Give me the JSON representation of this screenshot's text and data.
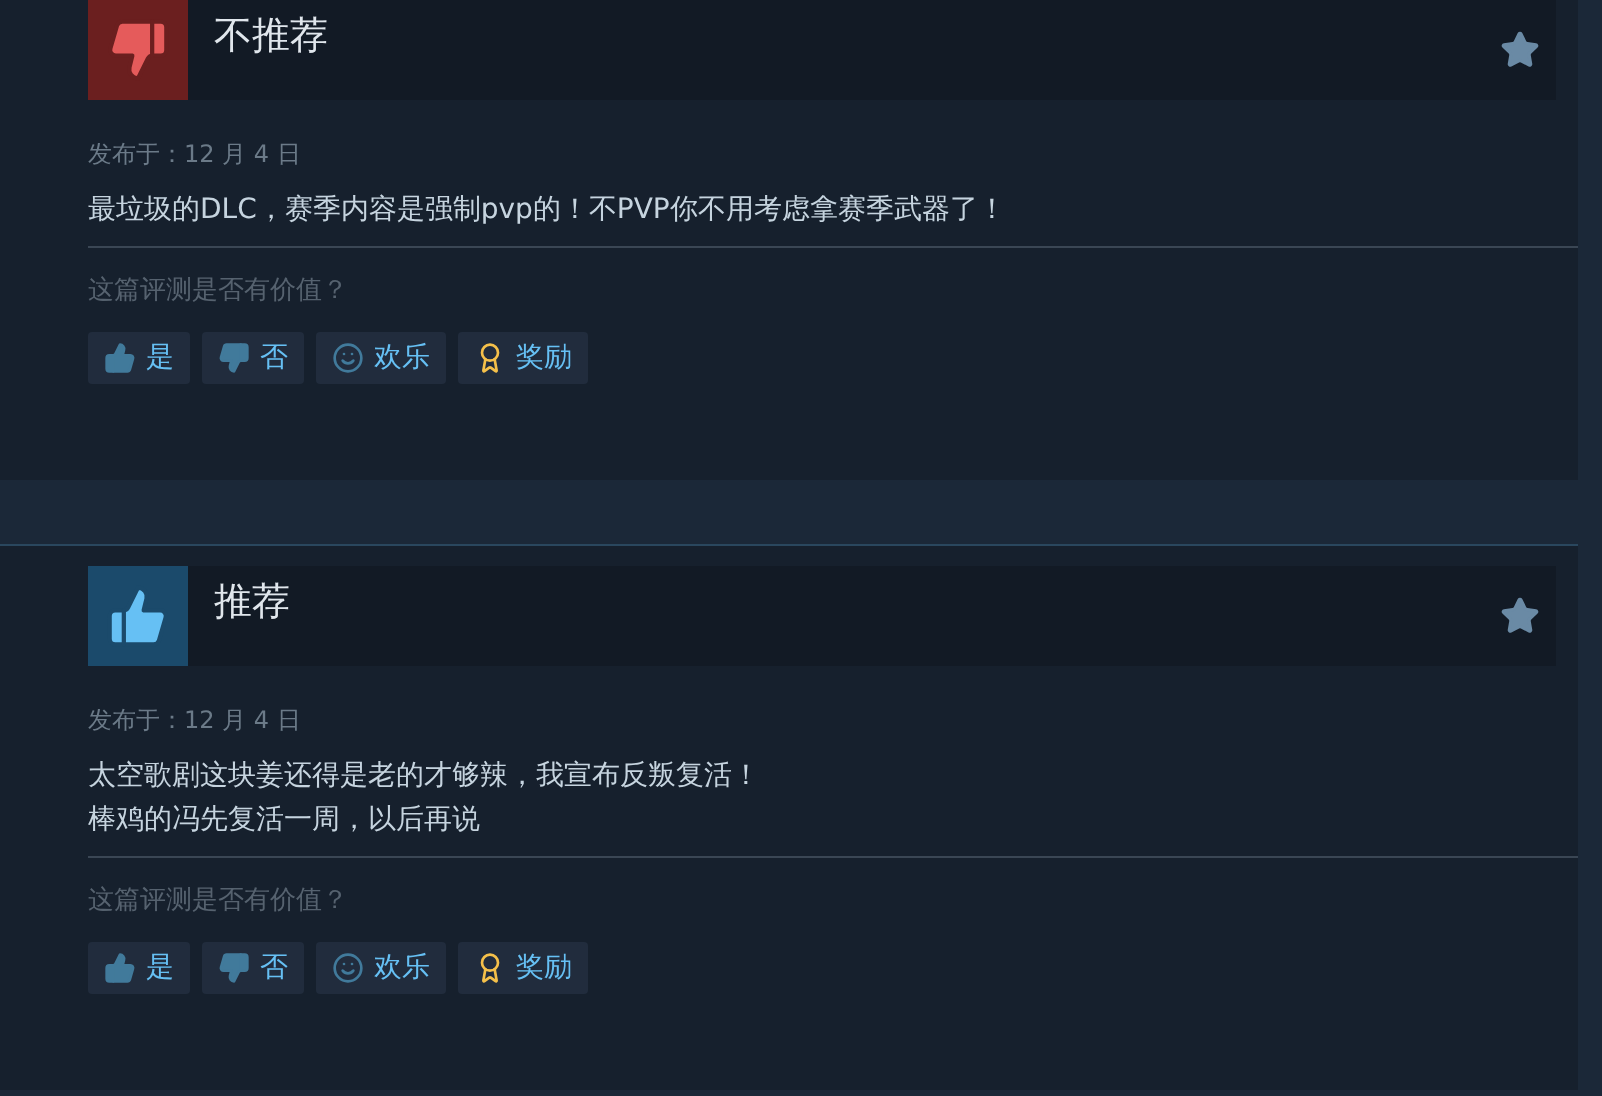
{
  "reviews": [
    {
      "kind": "not_recommended",
      "verdict": "不推荐",
      "posted": "发布于：12 月 4 日",
      "body": [
        "最垃圾的DLC，赛季内容是强制pvp的！不PVP你不用考虑拿赛季武器了！"
      ],
      "question": "这篇评测是否有价值？",
      "buttons": [
        {
          "kind": "yes",
          "label": "是"
        },
        {
          "kind": "no",
          "label": "否"
        },
        {
          "kind": "funny",
          "label": "欢乐"
        },
        {
          "kind": "award",
          "label": "奖励"
        }
      ]
    },
    {
      "kind": "recommended",
      "verdict": "推荐",
      "posted": "发布于：12 月 4 日",
      "body": [
        "太空歌剧这块姜还得是老的才够辣，我宣布反叛复活！",
        "棒鸡的冯先复活一周，以后再说"
      ],
      "question": "这篇评测是否有价值？",
      "buttons": [
        {
          "kind": "yes",
          "label": "是"
        },
        {
          "kind": "no",
          "label": "否"
        },
        {
          "kind": "funny",
          "label": "欢乐"
        },
        {
          "kind": "award",
          "label": "奖励"
        }
      ]
    }
  ]
}
